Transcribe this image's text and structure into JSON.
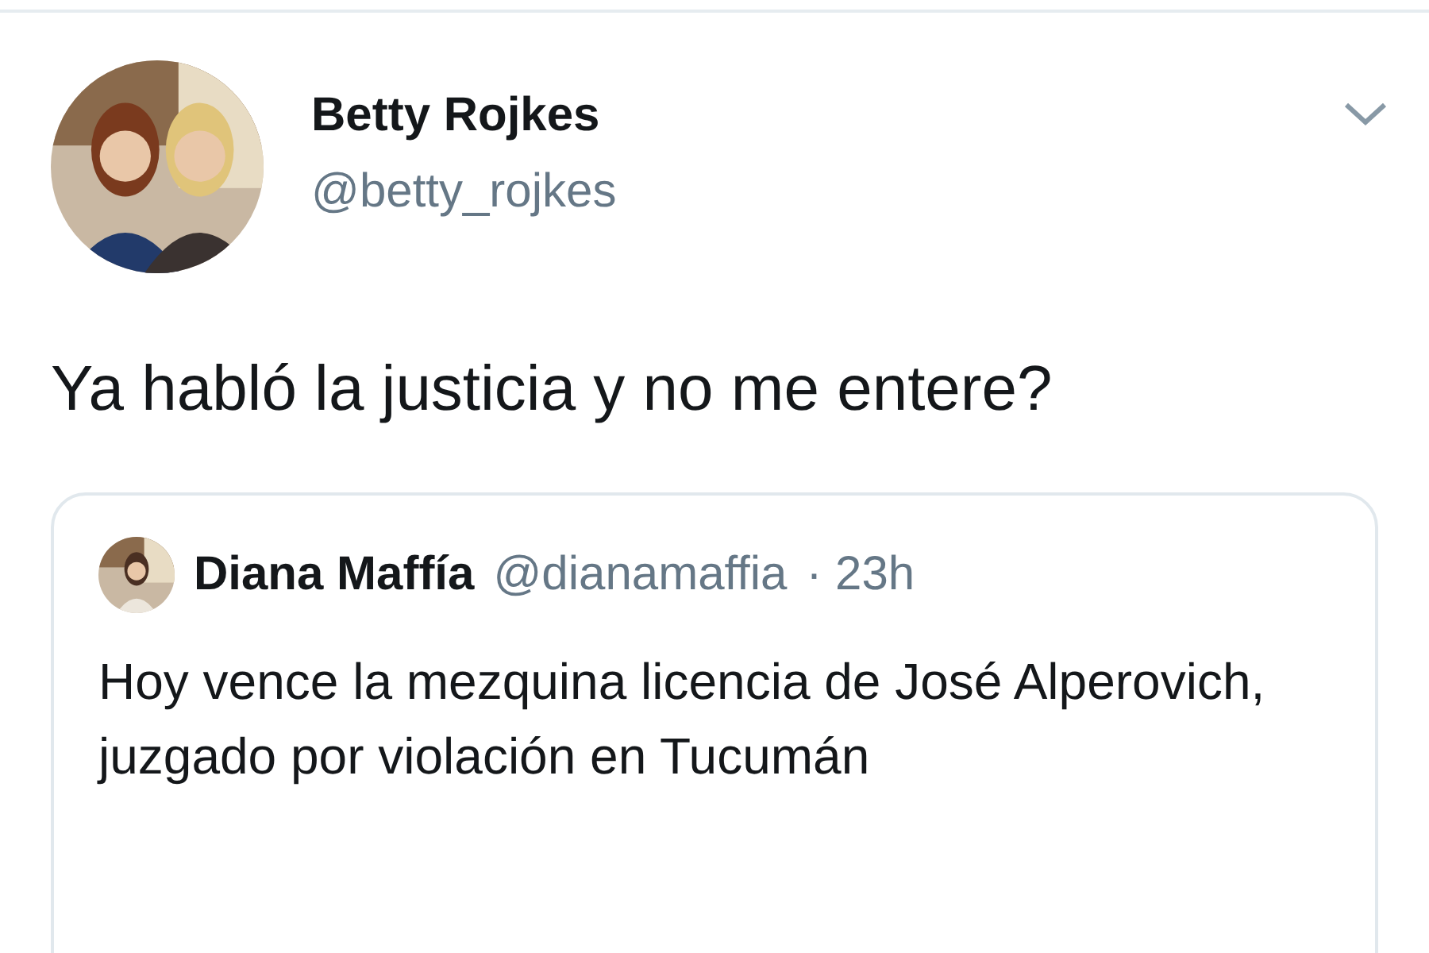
{
  "tweet": {
    "author": {
      "name": "Betty Rojkes",
      "handle": "@betty_rojkes"
    },
    "text": "Ya habló la justicia y no me entere?",
    "quoted_tweet": {
      "author": {
        "name": "Diana Maffía",
        "handle": "@dianamaffia"
      },
      "time": "· 23h",
      "text": "Hoy vence la mezquina licencia de José Alperovich, juzgado por violación en Tucumán"
    }
  }
}
